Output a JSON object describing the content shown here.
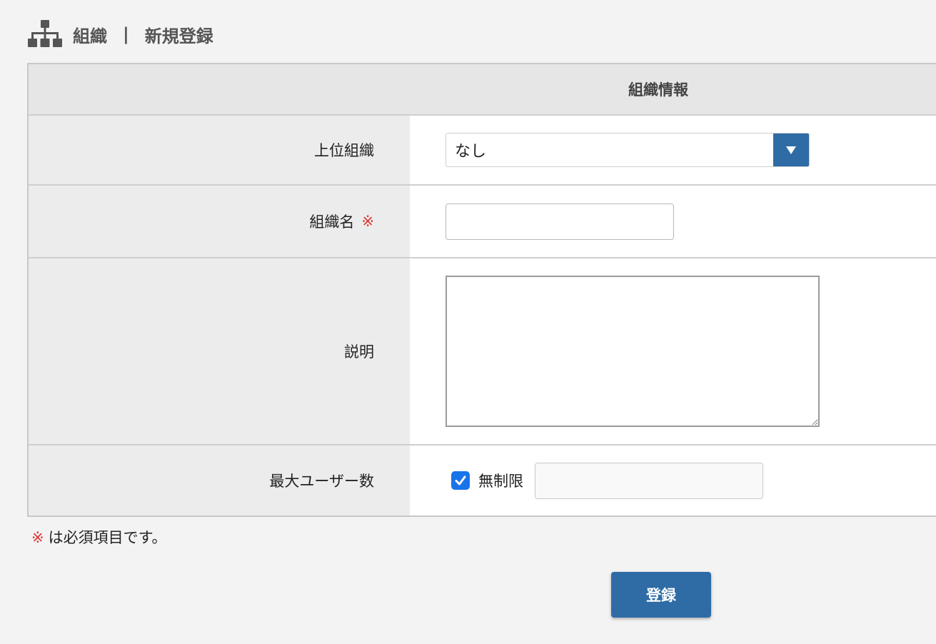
{
  "header": {
    "icon": "sitemap-icon",
    "section": "組織",
    "separator": "|",
    "page": "新規登録"
  },
  "table": {
    "heading": "組織情報",
    "rows": {
      "parent": {
        "label": "上位組織",
        "value": "なし"
      },
      "name": {
        "label": "組織名",
        "required_mark": "※",
        "value": ""
      },
      "description": {
        "label": "説明",
        "value": ""
      },
      "max_users": {
        "label": "最大ユーザー数",
        "unlimited_label": "無制限",
        "unlimited_checked": true,
        "value": ""
      }
    }
  },
  "note": {
    "mark": "※",
    "text": "は必須項目です。"
  },
  "submit": {
    "label": "登録"
  },
  "colors": {
    "accent": "#2f6ca6",
    "required": "#dd3333",
    "checkbox": "#1a73e8"
  }
}
